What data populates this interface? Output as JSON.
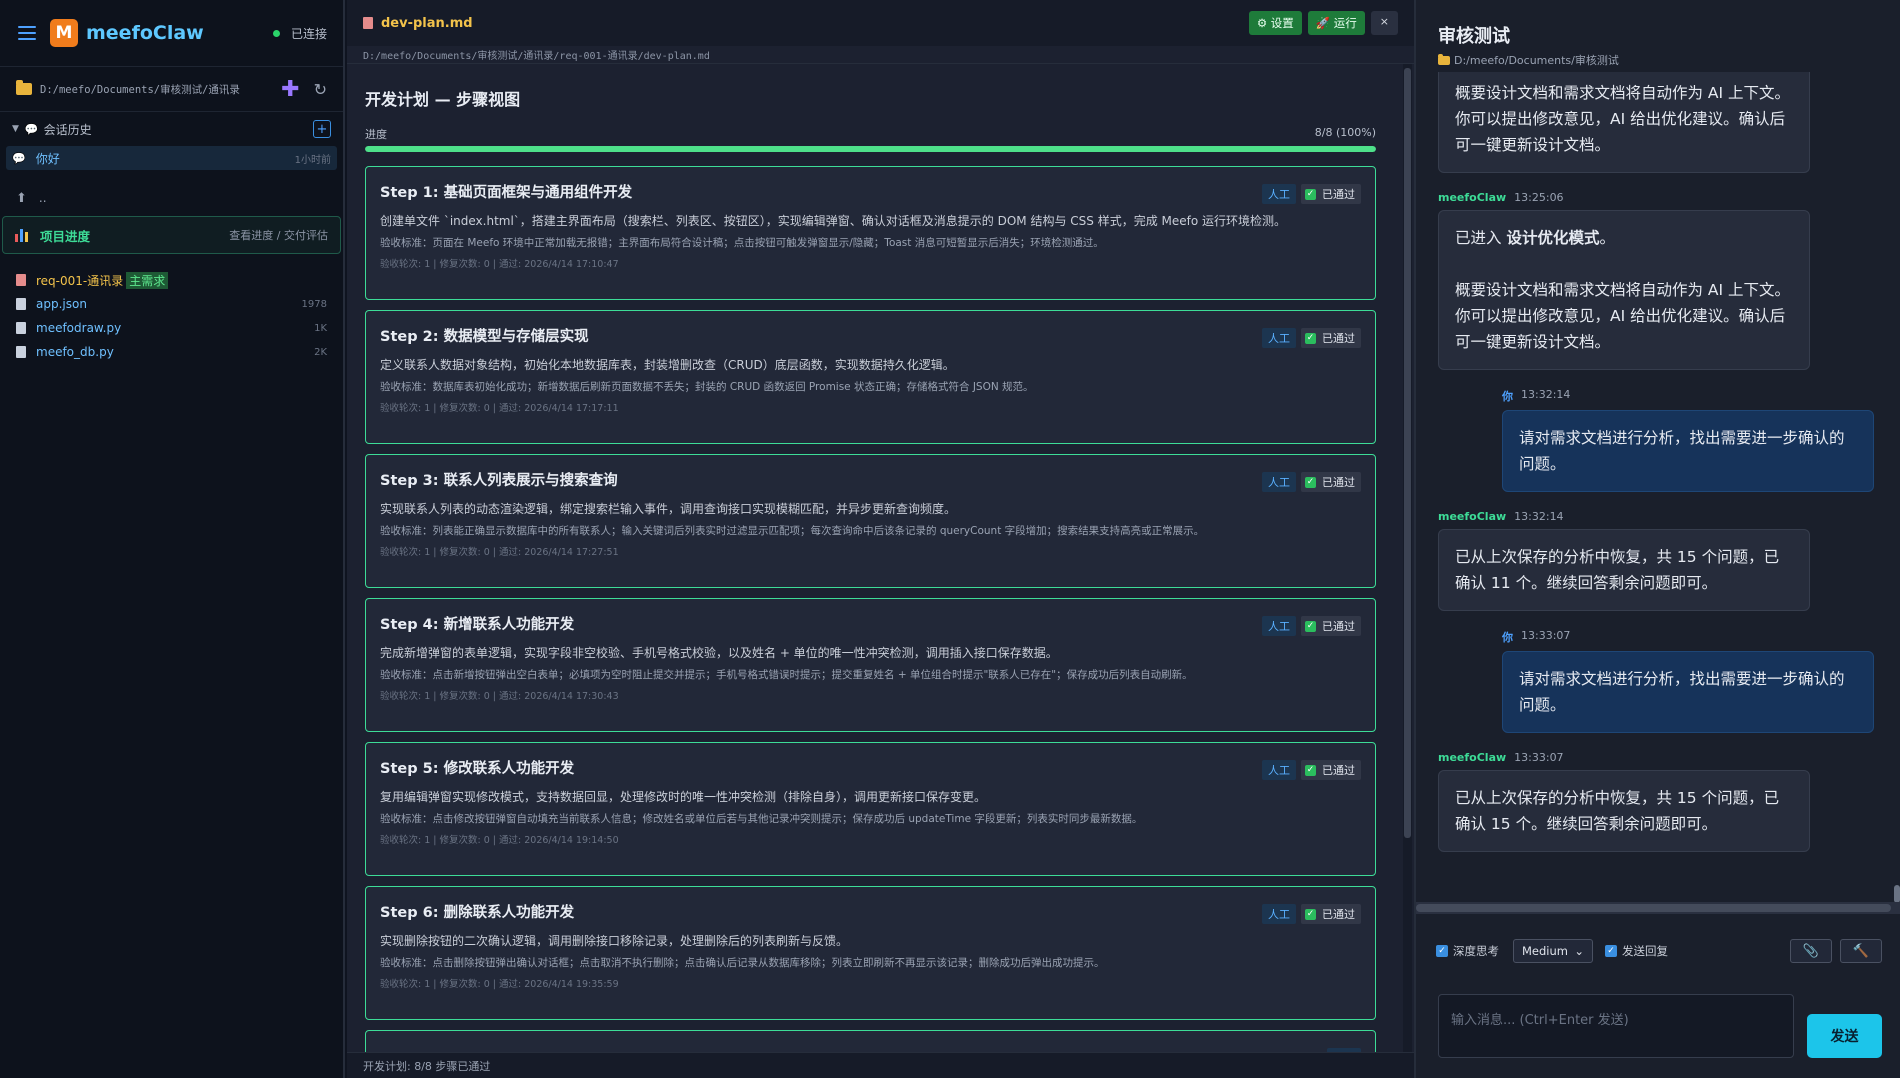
{
  "sidebar": {
    "brand_name": "meefoClaw",
    "connection": "已连接",
    "path": "D:/meefo/Documents/审核测试/通讯录",
    "history_label": "会话历史",
    "history_items": [
      {
        "label": "你好",
        "time": "1小时前"
      }
    ],
    "up_label": "..",
    "progress_title": "项目进度",
    "progress_link": "查看进度 / 交付评估",
    "files": [
      {
        "name": "req-001-通讯录",
        "tag": "主需求",
        "size": ""
      },
      {
        "name": "app.json",
        "size": "1978"
      },
      {
        "name": "meefodraw.py",
        "size": "1K"
      },
      {
        "name": "meefo_db.py",
        "size": "2K"
      }
    ]
  },
  "editor": {
    "tab_name": "dev-plan.md",
    "settings_label": "⚙ 设置",
    "run_label": "🚀 运行",
    "close_label": "×",
    "file_path": "D:/meefo/Documents/审核测试/通讯录/req-001-通讯录/dev-plan.md",
    "heading": "开发计划 — 步骤视图",
    "progress_label": "进度",
    "progress_value": "8/8 (100%)",
    "progress_fraction": 1.0,
    "badge_person": "人工",
    "badge_pass": "已通过",
    "steps": [
      {
        "title": "Step 1: 基础页面框架与通用组件开发",
        "desc": "创建单文件 `index.html`，搭建主界面布局（搜索栏、列表区、按钮区），实现编辑弹窗、确认对话框及消息提示的 DOM 结构与 CSS 样式，完成 Meefo 运行环境检测。",
        "acc": "验收标准：页面在 Meefo 环境中正常加载无报错；主界面布局符合设计稿；点击按钮可触发弹窗显示/隐藏；Toast 消息可短暂显示后消失；环境检测通过。",
        "meta": "验收轮次: 1 | 修复次数: 0 | 通过: 2026/4/14 17:10:47"
      },
      {
        "title": "Step 2: 数据模型与存储层实现",
        "desc": "定义联系人数据对象结构，初始化本地数据库表，封装增删改查（CRUD）底层函数，实现数据持久化逻辑。",
        "acc": "验收标准：数据库表初始化成功；新增数据后刷新页面数据不丢失；封装的 CRUD 函数返回 Promise 状态正确；存储格式符合 JSON 规范。",
        "meta": "验收轮次: 1 | 修复次数: 0 | 通过: 2026/4/14 17:17:11"
      },
      {
        "title": "Step 3: 联系人列表展示与搜索查询",
        "desc": "实现联系人列表的动态渲染逻辑，绑定搜索栏输入事件，调用查询接口实现模糊匹配，并异步更新查询频度。",
        "acc": "验收标准：列表能正确显示数据库中的所有联系人；输入关键词后列表实时过滤显示匹配项；每次查询命中后该条记录的 queryCount 字段增加；搜索结果支持高亮或正常展示。",
        "meta": "验收轮次: 1 | 修复次数: 0 | 通过: 2026/4/14 17:27:51"
      },
      {
        "title": "Step 4: 新增联系人功能开发",
        "desc": "完成新增弹窗的表单逻辑，实现字段非空校验、手机号格式校验，以及姓名 + 单位的唯一性冲突检测，调用插入接口保存数据。",
        "acc": "验收标准：点击新增按钮弹出空白表单；必填项为空时阻止提交并提示；手机号格式错误时提示；提交重复姓名 + 单位组合时提示\"联系人已存在\"；保存成功后列表自动刷新。",
        "meta": "验收轮次: 1 | 修复次数: 0 | 通过: 2026/4/14 17:30:43"
      },
      {
        "title": "Step 5: 修改联系人功能开发",
        "desc": "复用编辑弹窗实现修改模式，支持数据回显，处理修改时的唯一性冲突检测（排除自身），调用更新接口保存变更。",
        "acc": "验收标准：点击修改按钮弹窗自动填充当前联系人信息；修改姓名或单位后若与其他记录冲突则提示；保存成功后 updateTime 字段更新；列表实时同步最新数据。",
        "meta": "验收轮次: 1 | 修复次数: 0 | 通过: 2026/4/14 19:14:50"
      },
      {
        "title": "Step 6: 删除联系人功能开发",
        "desc": "实现删除按钮的二次确认逻辑，调用删除接口移除记录，处理删除后的列表刷新与反馈。",
        "acc": "验收标准：点击删除按钮弹出确认对话框；点击取消不执行删除；点击确认后记录从数据库移除；列表立即刷新不再显示该记录；删除成功后弹出成功提示。",
        "meta": "验收轮次: 1 | 修复次数: 0 | 通过: 2026/4/14 19:35:59"
      }
    ],
    "footer": "开发计划: 8/8 步骤已通过"
  },
  "chat": {
    "title": "审核测试",
    "path": "D:/meefo/Documents/审核测试",
    "messages": [
      {
        "role": "ai",
        "cut": true,
        "text": "概要设计文档和需求文档将自动作为 AI 上下文。你可以提出修改意见，AI 给出优化建议。确认后可一键更新设计文档。"
      },
      {
        "role": "ai",
        "who": "meefoClaw",
        "time": "13:25:06",
        "text_pre": "已进入 ",
        "text_bold": "设计优化模式",
        "text_post": "。",
        "text2": "概要设计文档和需求文档将自动作为 AI 上下文。你可以提出修改意见，AI 给出优化建议。确认后可一键更新设计文档。"
      },
      {
        "role": "user",
        "who": "你",
        "time": "13:32:14",
        "text": "请对需求文档进行分析，找出需要进一步确认的问题。"
      },
      {
        "role": "ai",
        "who": "meefoClaw",
        "time": "13:32:14",
        "text": "已从上次保存的分析中恢复，共 15 个问题，已确认 11 个。继续回答剩余问题即可。"
      },
      {
        "role": "user",
        "who": "你",
        "time": "13:33:07",
        "text": "请对需求文档进行分析，找出需要进一步确认的问题。"
      },
      {
        "role": "ai",
        "who": "meefoClaw",
        "time": "13:33:07",
        "text": "已从上次保存的分析中恢复，共 15 个问题，已确认 15 个。继续回答剩余问题即可。"
      }
    ],
    "deep_think_label": "深度思考",
    "effort_value": "Medium",
    "send_reply_label": "发送回复",
    "input_placeholder": "输入消息... (Ctrl+Enter 发送)",
    "send_label": "发送"
  },
  "colors": {
    "accent_green": "#3ddc97",
    "accent_blue": "#4ea1ff",
    "send_button": "#1cc5ea",
    "brand_logo": "#f07c1c"
  }
}
